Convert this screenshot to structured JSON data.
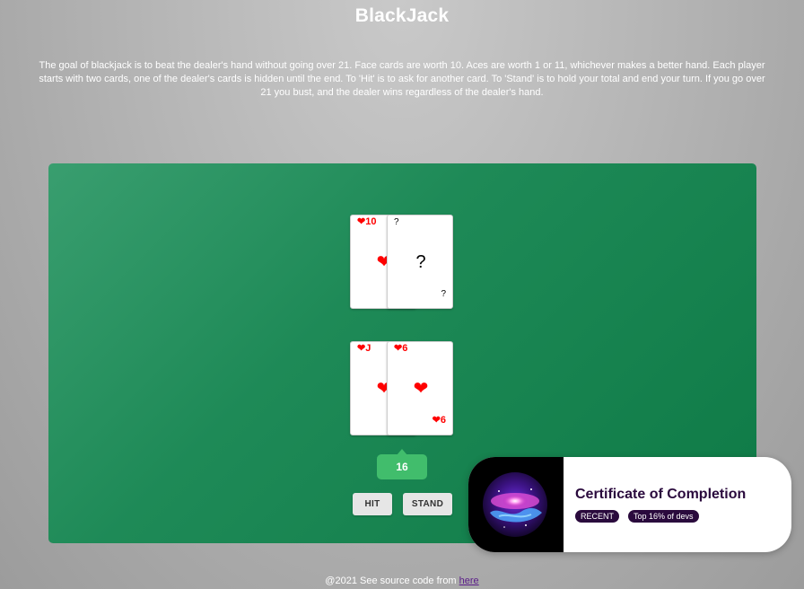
{
  "title": "BlackJack",
  "rules": "The goal of blackjack is to beat the dealer's hand without going over 21. Face cards are worth 10. Aces are worth 1 or 11, whichever makes a better hand. Each player starts with two cards, one of the dealer's cards is hidden until the end. To 'Hit' is to ask for another card. To 'Stand' is to hold your total and end your turn. If you go over 21 you bust, and the dealer wins regardless of the dealer's hand.",
  "colors": {
    "table": "#1e8a57",
    "score_badge": "#41bd6c",
    "card_red": "#ff0000",
    "certificate_text": "#2a0a3d"
  },
  "dealer": {
    "cards": [
      {
        "corner": "❤10",
        "suit_icon": "heart-icon",
        "center": "❤"
      },
      {
        "corner_top": "?",
        "center": "?",
        "corner_bottom": "?"
      }
    ]
  },
  "player": {
    "cards": [
      {
        "corner": "❤J",
        "suit_icon": "heart-icon",
        "center": "❤"
      },
      {
        "corner_top": "❤6",
        "center": "❤",
        "corner_bottom": "❤6",
        "suit_icon": "heart-icon"
      }
    ],
    "score": "16"
  },
  "buttons": {
    "hit": "HIT",
    "stand": "STAND"
  },
  "footer": {
    "text": "@2021 See source code from ",
    "link": "here"
  },
  "certificate": {
    "title": "Certificate of Completion",
    "badge_recent": "RECENT",
    "badge_top": "Top 16% of devs",
    "image_icon": "galaxy-icon"
  }
}
